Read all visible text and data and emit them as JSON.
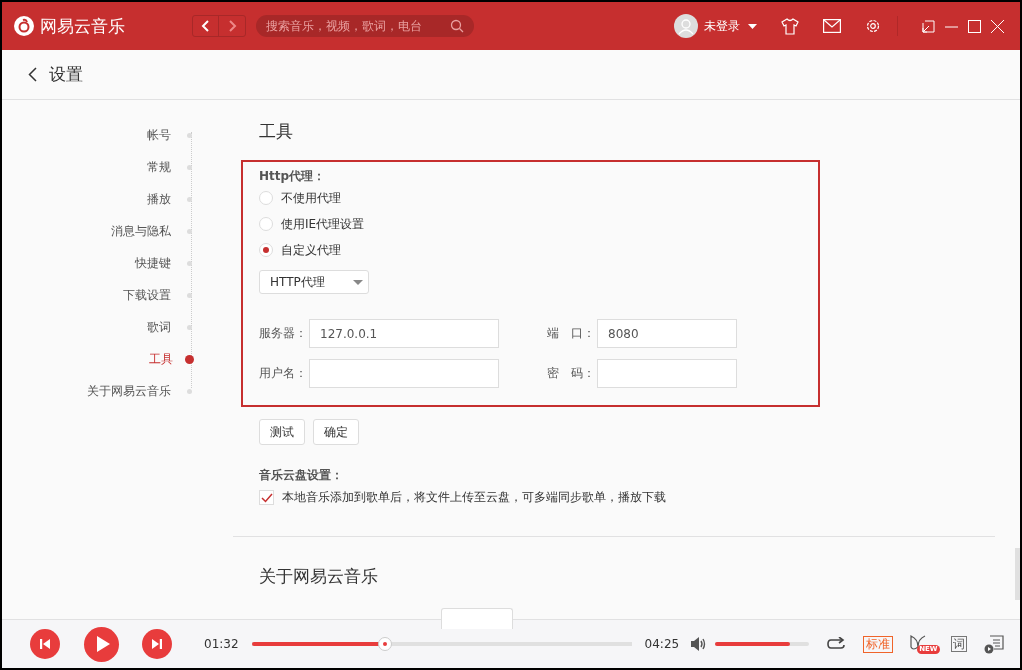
{
  "app": {
    "name": "网易云音乐"
  },
  "header": {
    "search": {
      "placeholder": "搜索音乐，视频，歌词，电台"
    },
    "user": "未登录"
  },
  "page": {
    "title": "设置"
  },
  "nav": [
    {
      "label": "帐号",
      "selected": false
    },
    {
      "label": "常规",
      "selected": false
    },
    {
      "label": "播放",
      "selected": false
    },
    {
      "label": "消息与隐私",
      "selected": false
    },
    {
      "label": "快捷键",
      "selected": false
    },
    {
      "label": "下载设置",
      "selected": false
    },
    {
      "label": "歌词",
      "selected": false
    },
    {
      "label": "工具",
      "selected": true
    },
    {
      "label": "关于网易云音乐",
      "selected": false
    }
  ],
  "section": {
    "title": "工具"
  },
  "proxy": {
    "label": "Http代理：",
    "options": [
      {
        "label": "不使用代理",
        "selected": false
      },
      {
        "label": "使用IE代理设置",
        "selected": false
      },
      {
        "label": "自定义代理",
        "selected": true
      }
    ],
    "type": "HTTP代理",
    "fields": [
      {
        "label": "服务器：",
        "value": "127.0.0.1"
      },
      {
        "label": "端　口：",
        "value": "8080"
      },
      {
        "label": "用户名："
      },
      {
        "label": "密　码："
      }
    ]
  },
  "buttons": [
    "测试",
    "确定"
  ],
  "cloud": {
    "label": "音乐云盘设置：",
    "option": {
      "label": "本地音乐添加到歌单后，将文件上传至云盘，可多端同步歌单，播放下载",
      "checked": true
    }
  },
  "about": {
    "title": "关于网易云音乐"
  },
  "player": {
    "elapsed": "01:32",
    "total": "04:25",
    "progress": {
      "level": 0.35
    },
    "volume": {
      "level": 0.8
    },
    "quality": "标准",
    "badge": "NEW",
    "lyrics": "词"
  }
}
